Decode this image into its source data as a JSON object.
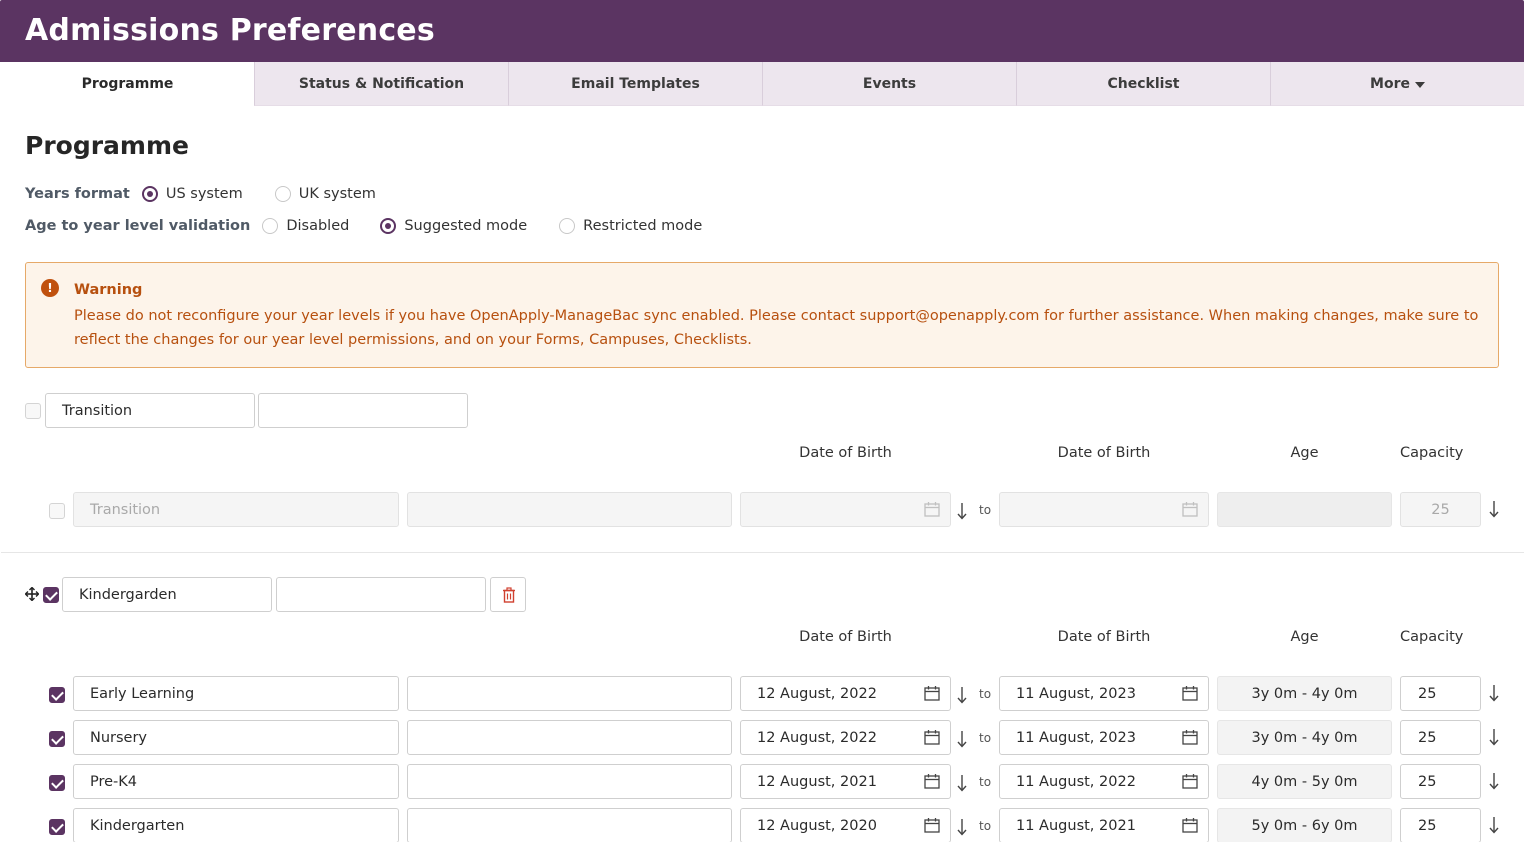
{
  "header": {
    "title": "Admissions Preferences"
  },
  "tabs": [
    {
      "label": "Programme",
      "active": true
    },
    {
      "label": "Status & Notification",
      "active": false
    },
    {
      "label": "Email Templates",
      "active": false
    },
    {
      "label": "Events",
      "active": false
    },
    {
      "label": "Checklist",
      "active": false
    },
    {
      "label": "More",
      "active": false
    }
  ],
  "section": {
    "title": "Programme"
  },
  "years_format": {
    "label": "Years format",
    "options": [
      {
        "label": "US system",
        "selected": true
      },
      {
        "label": "UK system",
        "selected": false
      }
    ]
  },
  "age_validation": {
    "label": "Age to year level validation",
    "options": [
      {
        "label": "Disabled",
        "selected": false
      },
      {
        "label": "Suggested mode",
        "selected": true
      },
      {
        "label": "Restricted mode",
        "selected": false
      }
    ]
  },
  "warning": {
    "title": "Warning",
    "text": "Please do not reconfigure your year levels if you have OpenApply-ManageBac sync enabled. Please contact support@openapply.com for further assistance. When making changes, make sure to reflect the changes for our year level permissions, and on your Forms, Campuses, Checklists."
  },
  "columns": {
    "dob_from": "Date of Birth",
    "dob_to": "Date of Birth",
    "age": "Age",
    "capacity": "Capacity",
    "to": "to"
  },
  "transition_group": {
    "name": "Transition",
    "checked": false,
    "row": {
      "name": "Transition",
      "capacity": "25",
      "checked": false
    }
  },
  "kindergarden_group": {
    "name": "Kindergarden",
    "checked": true,
    "rows": [
      {
        "name": "Early Learning",
        "dob_from": "12 August, 2022",
        "dob_to": "11 August, 2023",
        "age": "3y 0m - 4y 0m",
        "capacity": "25",
        "checked": true
      },
      {
        "name": "Nursery",
        "dob_from": "12 August, 2022",
        "dob_to": "11 August, 2023",
        "age": "3y 0m - 4y 0m",
        "capacity": "25",
        "checked": true
      },
      {
        "name": "Pre-K4",
        "dob_from": "12 August, 2021",
        "dob_to": "11 August, 2022",
        "age": "4y 0m - 5y 0m",
        "capacity": "25",
        "checked": true
      },
      {
        "name": "Kindergarten",
        "dob_from": "12 August, 2020",
        "dob_to": "11 August, 2021",
        "age": "5y 0m - 6y 0m",
        "capacity": "25",
        "checked": true
      }
    ]
  }
}
